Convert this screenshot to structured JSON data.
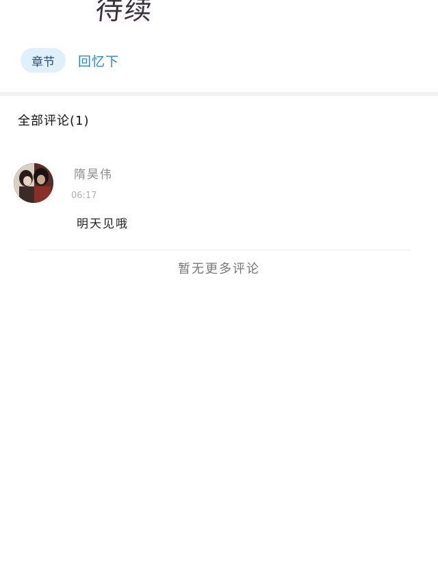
{
  "banner": {
    "text": "待续"
  },
  "chapter": {
    "tag_label": "章节",
    "name": "回忆下"
  },
  "comments": {
    "title": "全部评论(1)",
    "items": [
      {
        "username": "隋昊伟",
        "time": "06:17",
        "text": "明天见哦",
        "avatar_icon": "user-avatar-photo"
      }
    ],
    "no_more": "暂无更多评论"
  },
  "colors": {
    "accent": "#2e86c1",
    "pill_bg": "#dff0fb",
    "divider": "#f2f2f4"
  }
}
